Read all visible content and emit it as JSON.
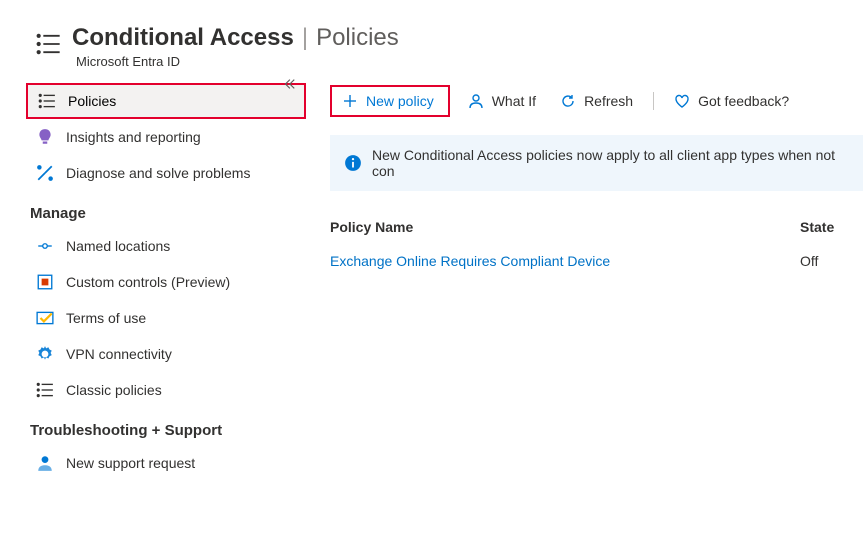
{
  "header": {
    "title": "Conditional Access",
    "page": "Policies",
    "subtitle": "Microsoft Entra ID"
  },
  "sidebar": {
    "items": [
      {
        "label": "Policies"
      },
      {
        "label": "Insights and reporting"
      },
      {
        "label": "Diagnose and solve problems"
      }
    ],
    "manage_heading": "Manage",
    "manage_items": [
      {
        "label": "Named locations"
      },
      {
        "label": "Custom controls (Preview)"
      },
      {
        "label": "Terms of use"
      },
      {
        "label": "VPN connectivity"
      },
      {
        "label": "Classic policies"
      }
    ],
    "support_heading": "Troubleshooting + Support",
    "support_items": [
      {
        "label": "New support request"
      }
    ]
  },
  "toolbar": {
    "new_policy": "New policy",
    "what_if": "What If",
    "refresh": "Refresh",
    "feedback": "Got feedback?"
  },
  "banner": {
    "text": "New Conditional Access policies now apply to all client app types when not con"
  },
  "table": {
    "col_name": "Policy Name",
    "col_state": "State",
    "rows": [
      {
        "name": "Exchange Online Requires Compliant Device",
        "state": "Off"
      }
    ]
  }
}
